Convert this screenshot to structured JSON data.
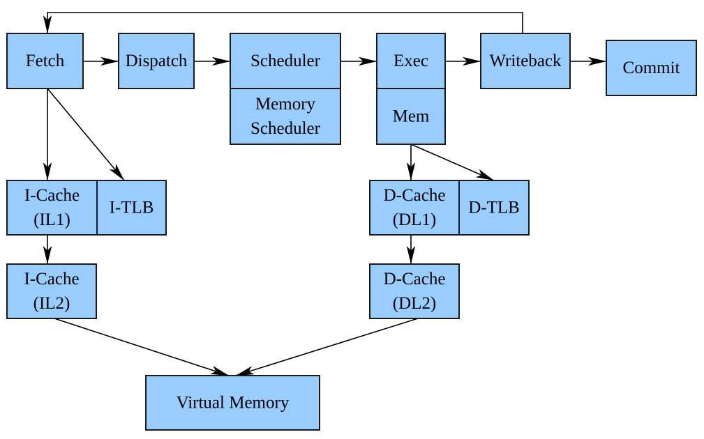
{
  "colors": {
    "box_fill": "#99ccff",
    "border": "#1a1a1a",
    "arrow": "#000000"
  },
  "nodes": {
    "fetch": [
      "Fetch"
    ],
    "dispatch": [
      "Dispatch"
    ],
    "scheduler": [
      "Scheduler"
    ],
    "memory_scheduler": [
      "Memory",
      "Scheduler"
    ],
    "exec": [
      "Exec"
    ],
    "mem": [
      "Mem"
    ],
    "writeback": [
      "Writeback"
    ],
    "commit": [
      "Commit"
    ],
    "icache_il1": [
      "I-Cache",
      "(IL1)"
    ],
    "itlb": [
      "I-TLB"
    ],
    "icache_il2": [
      "I-Cache",
      "(IL2)"
    ],
    "dcache_dl1": [
      "D-Cache",
      "(DL1)"
    ],
    "dtlb": [
      "D-TLB"
    ],
    "dcache_dl2": [
      "D-Cache",
      "(DL2)"
    ],
    "virtual_memory": [
      "Virtual Memory"
    ]
  }
}
